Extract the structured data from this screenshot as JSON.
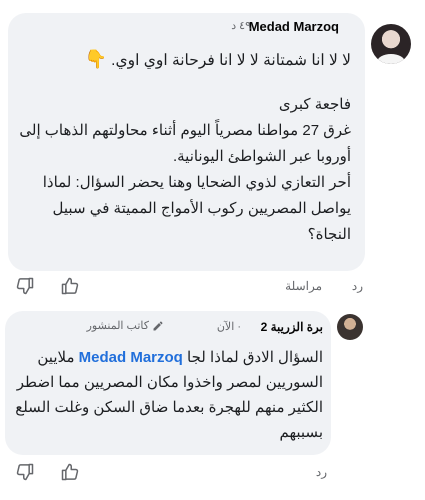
{
  "comment1": {
    "author": "Medad Marzoq",
    "time": "٤٩ د",
    "first_line": "لا لا انا شمتانة لا لا انا فرحانة اوي اوي.",
    "first_line_emoji": "backhand-index-pointing-down",
    "paragraphs": [
      "فاجعة كبرى",
      "غرق 27 مواطنا مصرياً اليوم أثناء محاولتهم الذهاب إلى أوروبا عبر الشواطئ اليونانية.",
      "أحر التعازي لذوي الضحايا وهنا يحضر السؤال: لماذا يواصل المصريين ركوب الأمواج المميتة في سبيل النجاة؟"
    ],
    "actions": {
      "reply": "رد",
      "message": "مراسلة"
    }
  },
  "comment2": {
    "author": "برة الزريبة 2",
    "time": "الآن",
    "author_badge": "كاتب المنشور",
    "mention": "Medad Marzoq",
    "first_text": "السؤال الادق لماذا لجا",
    "rest": "ملايين السوريين لمصر واخذوا مكان المصريين مما اضطر الكثير منهم للهجرة بعدما ضاق السكن وغلت السلع بسببهم",
    "actions": {
      "reply": "رد"
    }
  },
  "colors": {
    "bubble": "#f0f2f5",
    "mention": "#216fdb",
    "meta": "#65676b"
  }
}
